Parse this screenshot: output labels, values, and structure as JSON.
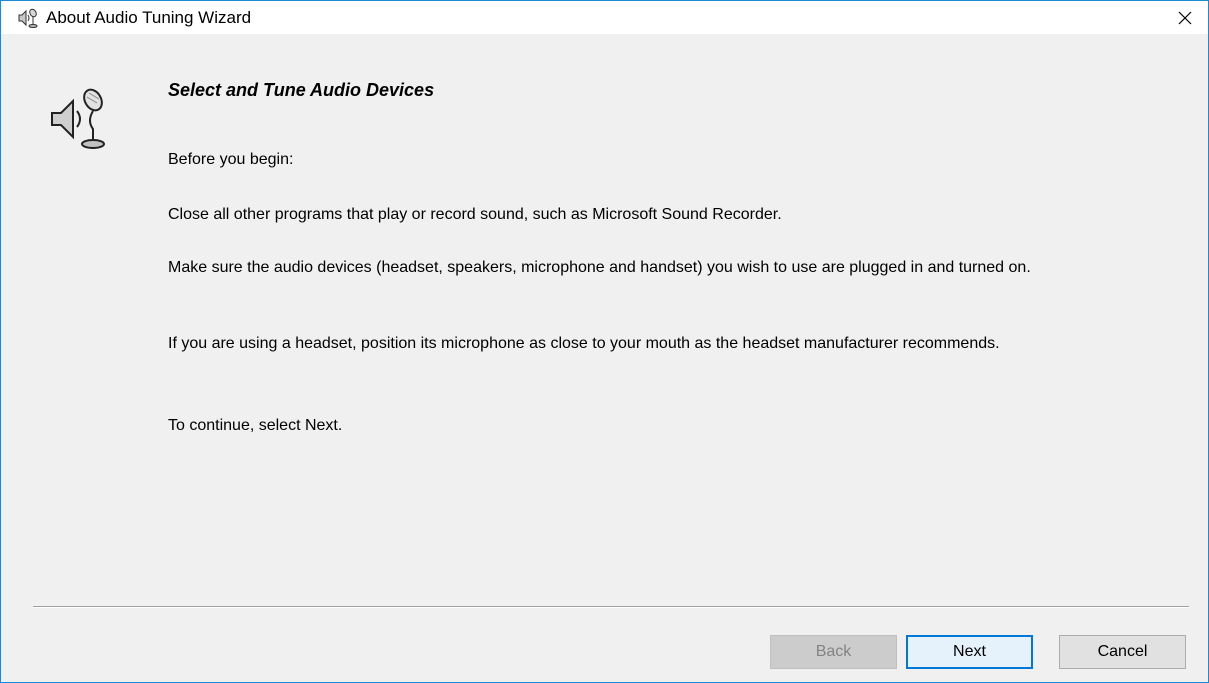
{
  "window": {
    "title": "About Audio Tuning Wizard",
    "title_icon": "speaker-microphone-icon",
    "close_icon": "close-icon"
  },
  "content": {
    "icon": "speaker-microphone-icon",
    "heading": "Select and Tune Audio Devices",
    "paragraphs": [
      "Before you begin:",
      "Close all other programs that play or record sound, such as Microsoft Sound Recorder.",
      "Make sure the audio devices (headset, speakers, microphone and handset) you wish to use are plugged in and turned on.",
      "If you are using a headset, position its microphone as close to your mouth as the headset manufacturer recommends.",
      "To continue, select Next."
    ]
  },
  "buttons": {
    "back": "Back",
    "next": "Next",
    "cancel": "Cancel"
  },
  "colors": {
    "accent": "#0078d7",
    "window_border": "#1a8ad6",
    "dialog_background": "#f0f0f0"
  }
}
